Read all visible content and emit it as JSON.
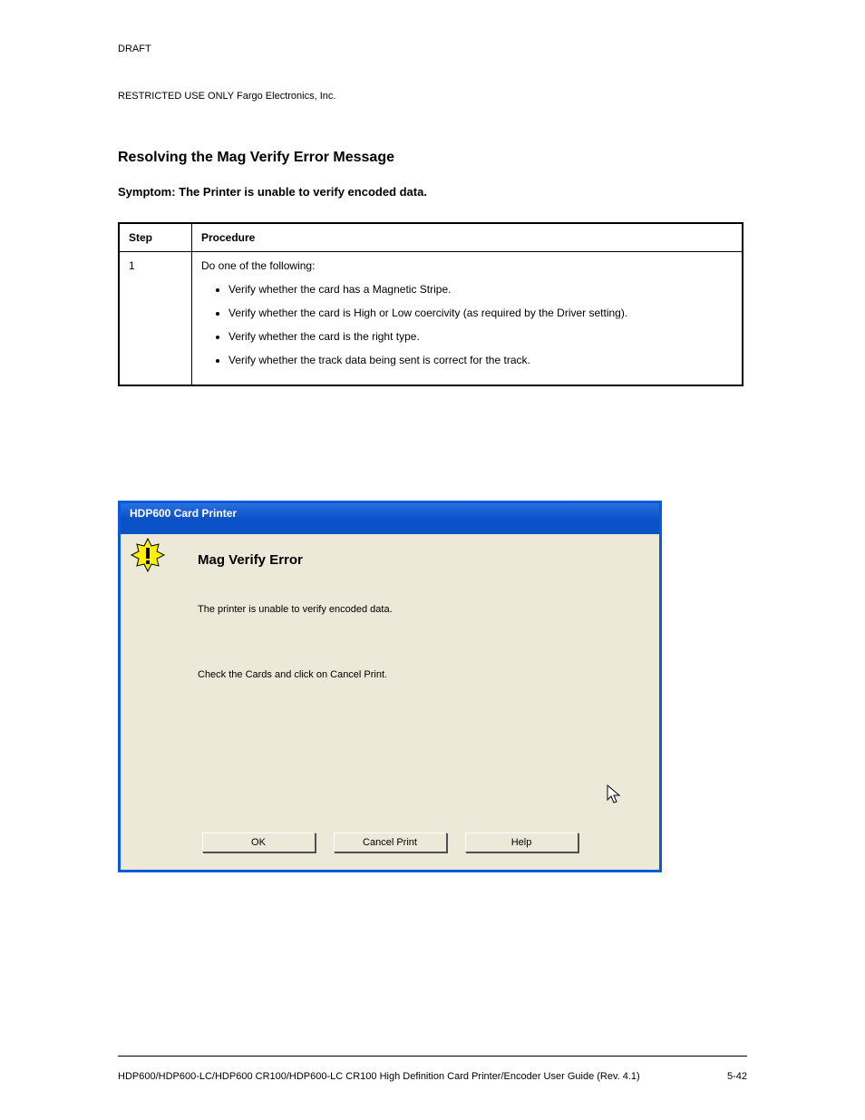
{
  "doc": {
    "header": "DRAFT",
    "restricted": "RESTRICTED USE ONLY                                             Fargo Electronics, Inc.",
    "section_title": "Resolving the Mag Verify Error Message",
    "section_subtitle": "Symptom: The Printer is unable to verify encoded data.",
    "footer_left1": "HDP600/HDP600-LC/HDP600 CR100/HDP600-LC CR100 High Definition Card Printer/Encoder User Guide (Rev. 4.1)",
    "footer_right": "5-42"
  },
  "table": {
    "h1": "Step",
    "h2": "Procedure",
    "r1c1": "1",
    "r1c2_lead": "Do one of the following: ",
    "r1c2_items": [
      "Verify whether the card has a Magnetic Stripe.",
      "Verify whether the card is High or Low coercivity (as required by the Driver setting).",
      "Verify whether the card is the right type.",
      "Verify whether the track data being sent is correct for the track."
    ]
  },
  "dialog": {
    "title": "HDP600 Card Printer",
    "heading": "Mag Verify Error",
    "line1": "The printer is unable to verify encoded data.",
    "line2": "Check the Cards and click on Cancel Print.",
    "btn_ok": "OK",
    "btn_cancel": "Cancel Print",
    "btn_help": "Help"
  }
}
